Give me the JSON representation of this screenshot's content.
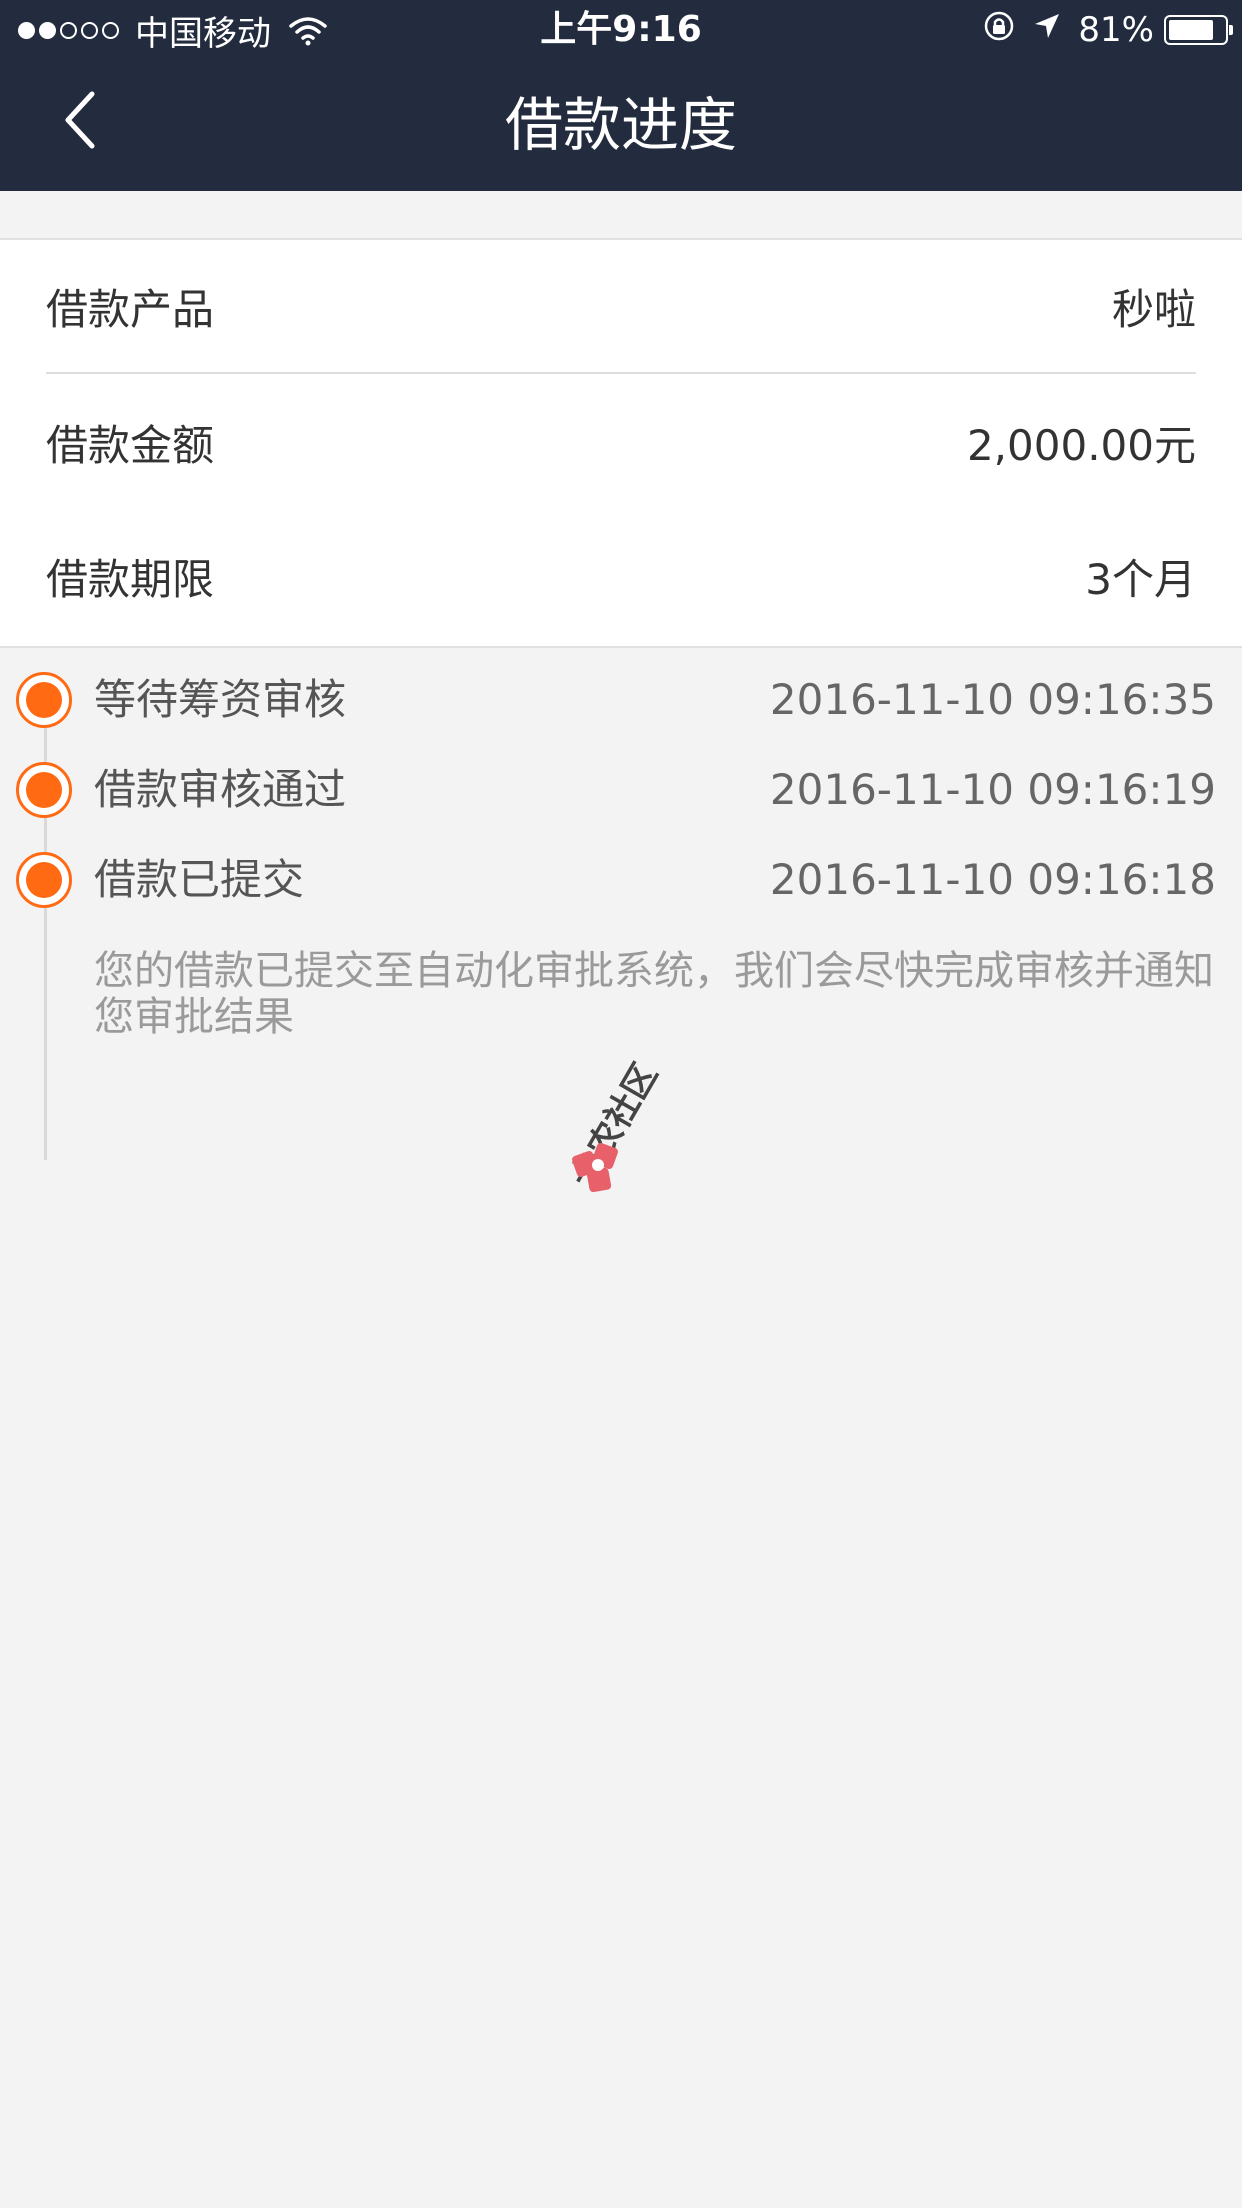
{
  "status_bar": {
    "carrier": "中国移动",
    "time": "上午9:16",
    "battery_text": "81%",
    "battery_level": 0.81,
    "signal_bars_filled": 2,
    "signal_bars_total": 5,
    "icons": [
      "wifi-icon",
      "rotation-lock-icon",
      "location-arrow-icon",
      "battery-icon"
    ]
  },
  "nav": {
    "title": "借款进度",
    "back_icon": "chevron-left-icon"
  },
  "details": [
    {
      "label": "借款产品",
      "value": "秒啦"
    },
    {
      "label": "借款金额",
      "value": "2,000.00元"
    },
    {
      "label": "借款期限",
      "value": "3个月"
    }
  ],
  "progress": [
    {
      "status": "等待筹资审核",
      "time": "2016-11-10 09:16:35"
    },
    {
      "status": "借款审核通过",
      "time": "2016-11-10 09:16:19"
    },
    {
      "status": "借款已提交",
      "time": "2016-11-10 09:16:18"
    }
  ],
  "progress_note": "您的借款已提交至自动化审批系统，我们会尽快完成审核并通知您审批结果",
  "watermark": {
    "text": "卡农社区",
    "icon": "kanong-logo-icon"
  },
  "colors": {
    "header_bg": "#232c3e",
    "accent_orange": "#ff6a13",
    "page_bg": "#f3f3f3",
    "card_bg": "#ffffff"
  }
}
